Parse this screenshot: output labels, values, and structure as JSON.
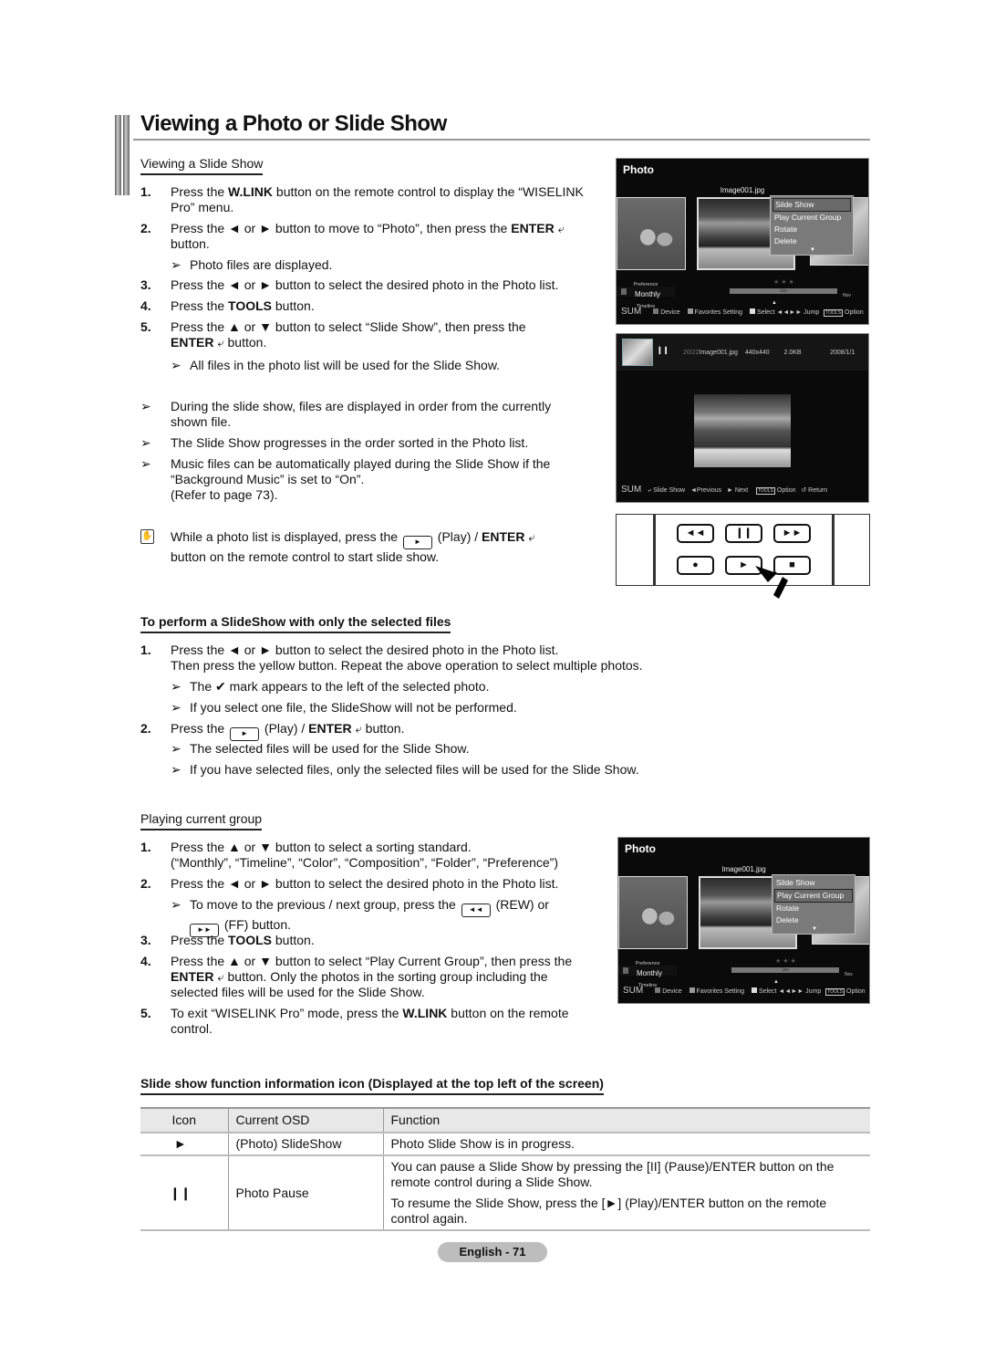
{
  "page": {
    "title": "Viewing a Photo or Slide Show",
    "page_label": "English - 71"
  },
  "section1": {
    "heading": "Viewing a Slide Show",
    "steps": [
      {
        "num": "1.",
        "pre": "Press the ",
        "bold": "W.LINK",
        "post": " button on the remote control to display the “WISELINK Pro” menu."
      },
      {
        "num": "2.",
        "pre": "Press the ◄ or ► button to move to “Photo”, then press the ",
        "bold": "ENTER",
        "post": " button."
      },
      {
        "num": "3.",
        "pre": "Press the ◄ or ► button to select the desired photo in the Photo list.",
        "bold": "",
        "post": ""
      },
      {
        "num": "4.",
        "pre": "Press the ",
        "bold": "TOOLS",
        "post": " button."
      },
      {
        "num": "5.",
        "pre": "Press the ▲ or ▼ button to select “Slide Show”, then press the ",
        "bold": "ENTER",
        "post": " button."
      }
    ],
    "step2_note": "Photo files are displayed.",
    "step5_note": "All files in the photo list will be used for the Slide Show.",
    "notes": [
      "During the slide show, files are displayed in order from the currently shown file.",
      "The Slide Show progresses in the order sorted in the Photo list.",
      "Music files can be automatically played during the Slide Show if the “Background Music” is set to “On”.",
      "(Refer to page 73)."
    ],
    "memo": {
      "pre": "While a photo list is displayed, press the",
      "play": "(Play) / ",
      "enter": "ENTER",
      "post": "button on the remote control to start slide show."
    }
  },
  "section2": {
    "heading": "To perform a SlideShow with only the selected files",
    "step1_line1": "Press the ◄ or ► button to select the desired photo in the Photo list.",
    "step1_line2": "Then press the yellow button. Repeat the above operation to select multiple photos.",
    "step1_notes": [
      "The ✔ mark appears to the left of the selected photo.",
      "If you select one file, the SlideShow will not be performed."
    ],
    "step2_pre": "Press the",
    "step2_play": "(Play) / ",
    "step2_enter": "ENTER",
    "step2_post": "button.",
    "step2_notes": [
      "The selected files will be used for the Slide Show.",
      "If you have selected files, only the selected files will be used for the Slide Show."
    ]
  },
  "section3": {
    "heading": "Playing current group",
    "step1_line1": "Press the ▲ or ▼ button to select a sorting standard.",
    "step1_line2": "(“Monthly”, “Timeline”, “Color”, “Composition”, “Folder”, “Preference”)",
    "step2": "Press the ◄ or ► button to select the desired photo in the Photo list.",
    "step2_note_pre": "To move to the previous / next group, press the",
    "step2_note_rew": "(REW) or",
    "step2_note_ff": "(FF) button.",
    "step3_pre": "Press the ",
    "step3_bold": "TOOLS",
    "step3_post": " button.",
    "step4_pre": "Press the ▲ or ▼ button to select “Play Current Group”, then press the ",
    "step4_bold": "ENTER",
    "step4_post": " button. Only the photos in the sorting group including the selected files will be used for the Slide Show.",
    "step5_pre": "To exit “WISELINK Pro” mode, press the ",
    "step5_bold": "W.LINK",
    "step5_post": " button on the remote control."
  },
  "osd_photo": {
    "header": "Photo",
    "filename": "Image001.jpg",
    "menu": [
      "Silde Show",
      "Play Current Group",
      "Rotate",
      "Delete"
    ],
    "sort_above": "Preference",
    "sort_current": "Monthly",
    "sort_below": "Timeline",
    "timeline_label": "Jan",
    "timeline_end": "Nov",
    "footer": {
      "sum": "SUM",
      "device": "Device",
      "favorites": "Favorites Setting",
      "select": "Select",
      "jump": "◄◄►► Jump",
      "tools": "TOOLS",
      "option": "Option"
    }
  },
  "osd_photo_2": {
    "selected_index": 1
  },
  "osd_slideshow": {
    "counter": "20/22",
    "filename": "Image001.jpg",
    "resolution": "440x440",
    "size": "2.0KB",
    "date": "2008/1/1",
    "footer": {
      "sum": "SUM",
      "slideshow": "Slide Show",
      "previous": "◄Previous",
      "next": "► Next",
      "tools": "TOOLS",
      "option": "Option",
      "return": "↺ Return"
    }
  },
  "remote": {
    "buttons": [
      "◄◄",
      "❙❙",
      "►►",
      "●",
      "►",
      "■"
    ]
  },
  "section4": {
    "heading": "Slide show function information icon (Displayed at the top left of the screen)",
    "columns": [
      "Icon",
      "Current OSD",
      "Function"
    ],
    "rows": [
      {
        "icon": "►",
        "osd": "(Photo) SlideShow",
        "function": [
          "Photo Slide Show is in progress."
        ]
      },
      {
        "icon": "❙❙",
        "osd": "Photo Pause",
        "function": [
          "You can pause a Slide Show by pressing the [II] (Pause)/ENTER button on the remote control during a Slide Show.",
          "To resume the Slide Show, press the [►] (Play)/ENTER button on the remote control again."
        ]
      }
    ]
  }
}
